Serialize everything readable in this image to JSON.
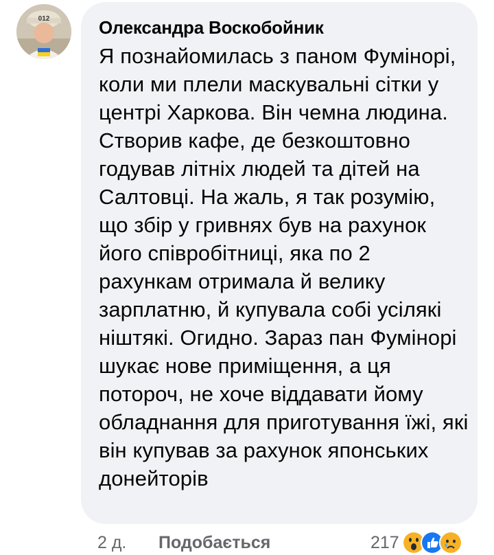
{
  "comment": {
    "author": "Олександра Воскобойник",
    "avatar": {
      "description_icon": "user-avatar",
      "cap_text": "012"
    },
    "text": "Я познайомилась з паном Фумінорі, коли ми плели маскувальні сітки у центрі Харкова. Він чемна людина. Створив кафе, де безкоштовно годував літніх людей та дітей на Салтовці. На жаль, я так розумію, що збір у гривнях був на рахунок його співробітниці, яка по 2 рахункам отримала й велику зарплатню, й купувала собі усілякі ніштякі. Огидно. Зараз пан Фумінорі шукає нове приміщення, а ця потороч, не хоче віддавати йому обладнання для приготування їжі, які він купував за рахунок японських донейторів"
  },
  "footer": {
    "time": "2 д.",
    "like_label": "Подобається",
    "reaction_count": "217",
    "reactions": [
      "wow-reaction-icon",
      "like-reaction-icon",
      "sad-reaction-icon"
    ]
  },
  "colors": {
    "bubble_bg": "#f0f2f5",
    "secondary_text": "#65676b",
    "like_blue": "#1877f2",
    "emoji_yellow": "#f7b125"
  }
}
